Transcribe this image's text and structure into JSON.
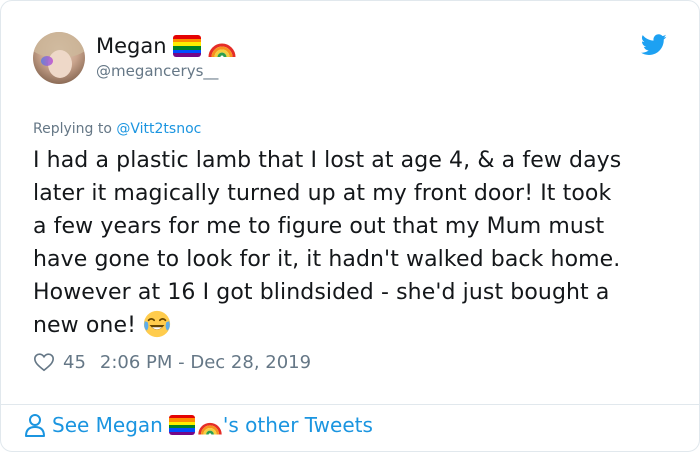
{
  "tweet": {
    "author_name": "Megan",
    "author_handle": "@megancerys__",
    "replying_prefix": "Replying to",
    "replying_to": "@Vitt2tsnoc",
    "body_lines": [
      "I had a plastic lamb that I lost at age 4, & a few days",
      "later it magically turned up at my front door! It took",
      "a few years for me to figure out that my Mum must",
      "have gone to look for it, it hadn't walked back home.",
      "However at 16 I got blindsided - she'd just bought a",
      "new one!"
    ],
    "likes": "45",
    "timestamp": "2:06 PM - Dec 28, 2019"
  },
  "footer": {
    "prefix": "See Megan",
    "suffix": "'s other Tweets"
  },
  "icons": {
    "pride_flag": "rainbow-flag-icon",
    "rainbow": "rainbow-icon",
    "twitter_bird": "twitter-bird-icon",
    "laughing_emoji": "face-with-tears-of-joy-icon",
    "heart": "heart-icon",
    "person": "person-icon"
  },
  "colors": {
    "link": "#1b95e0",
    "secondary_text": "#657786",
    "primary_text": "#14171a",
    "border": "#e1e8ed"
  }
}
